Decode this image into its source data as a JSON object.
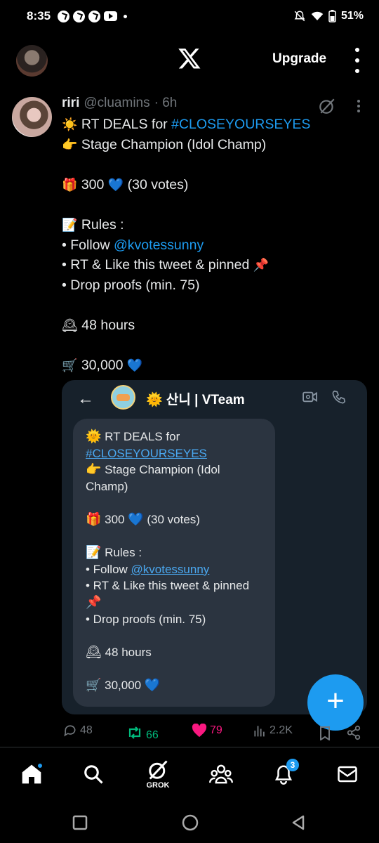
{
  "status_bar": {
    "time": "8:35",
    "battery": "51%"
  },
  "top_nav": {
    "upgrade_label": "Upgrade"
  },
  "tweet": {
    "name": "riri",
    "handle": "@cluamins",
    "time": "· 6h",
    "lines": [
      {
        "emoji": "☀️",
        "pre": " RT DEALS for ",
        "link": "#CLOSEYOURSEYES"
      },
      {
        "emoji": "👉",
        "pre": " Stage Champion (Idol Champ)"
      },
      {
        "blank": true
      },
      {
        "emoji": "🎁",
        "pre": " 300 ",
        "emoji2": "💙",
        "post": " (30 votes)"
      },
      {
        "blank": true
      },
      {
        "emoji": "📝",
        "pre": " Rules :"
      },
      {
        "pre": "• Follow ",
        "link": "@kvotessunny"
      },
      {
        "pre": "• RT & Like this tweet & pinned ",
        "emoji2": "📌"
      },
      {
        "pre": "• Drop proofs (min. 75)"
      },
      {
        "blank": true
      },
      {
        "emoji": "🕰",
        "pre": " 48 hours"
      },
      {
        "blank": true
      },
      {
        "emoji": "🛒",
        "pre": " 30,000 ",
        "emoji2": "💙"
      }
    ],
    "card": {
      "back": "←",
      "chat_title": "🌞 산니 | VTeam",
      "bubble_lines": [
        {
          "emoji": "🌞",
          "pre": " RT DEALS for"
        },
        {
          "ulink": "#CLOSEYOURSEYES"
        },
        {
          "emoji": "👉",
          "pre": " Stage Champion (Idol"
        },
        {
          "pre": "Champ)"
        },
        {
          "blank": true
        },
        {
          "emoji": "🎁",
          "pre": " 300 ",
          "emoji2": "💙",
          "post": " (30 votes)"
        },
        {
          "blank": true
        },
        {
          "emoji": "📝",
          "pre": " Rules :"
        },
        {
          "pre": "• Follow ",
          "ulink": "@kvotessunny"
        },
        {
          "pre": "• RT & Like this tweet & pinned"
        },
        {
          "emoji": "📌"
        },
        {
          "pre": "• Drop proofs (min. 75)"
        },
        {
          "blank": true
        },
        {
          "emoji": "🕰",
          "pre": " 48 hours"
        },
        {
          "blank": true
        },
        {
          "emoji": "🛒",
          "pre": " 30,000 ",
          "emoji2": "💙"
        }
      ]
    },
    "actions": {
      "replies": "48",
      "retweets": "66",
      "likes": "79",
      "views": "2.2K"
    }
  },
  "bottom_nav": {
    "grok_label": "GROK",
    "notifications_count": "3"
  },
  "colors": {
    "accent": "#1d9bf0",
    "retweet": "#00ba7c",
    "like": "#f91880",
    "muted": "#71767b"
  }
}
